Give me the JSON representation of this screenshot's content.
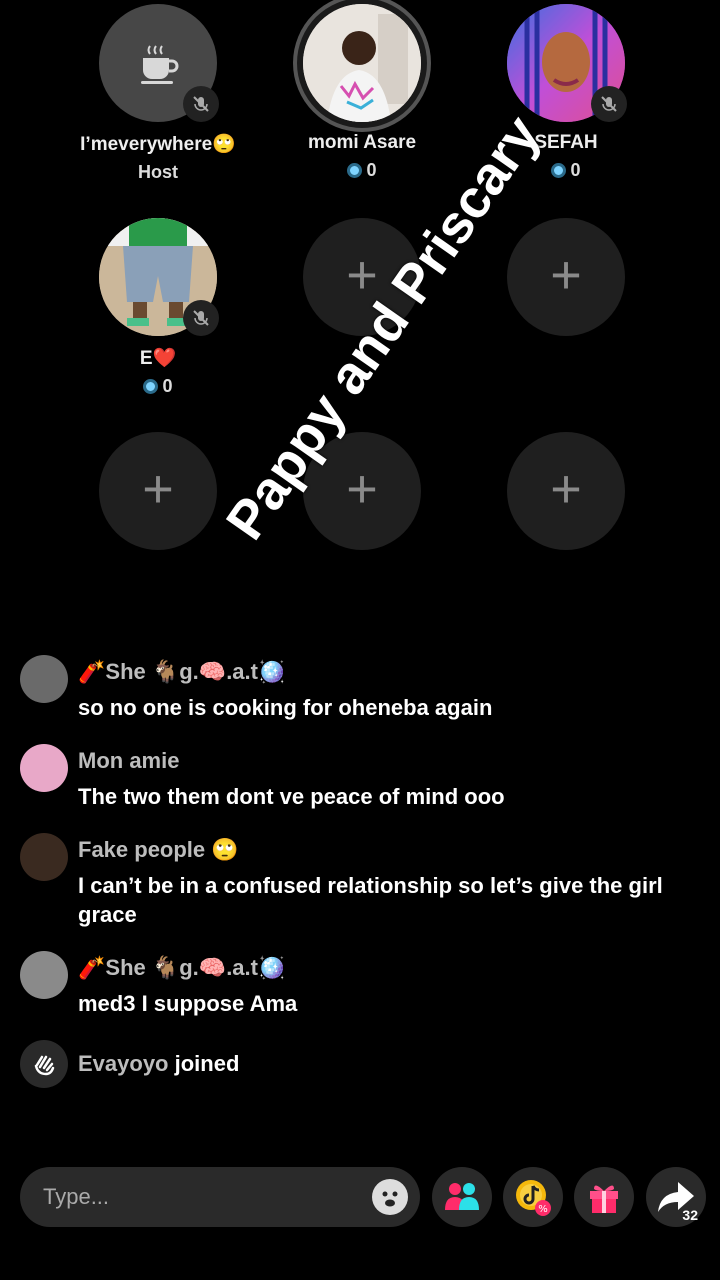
{
  "seats": [
    {
      "name": "I’meverywhere🙄",
      "sub": "Host"
    },
    {
      "name": "momi Asare",
      "score": "0"
    },
    {
      "name": "SEFAH",
      "score": "0"
    },
    {
      "name": "E❤️",
      "score": "0"
    }
  ],
  "watermark": "Pappy and Priscary",
  "comments": [
    {
      "user": "🧨She 🐐g.🧠.a.t🪩",
      "text": "so no one is cooking for oheneba again"
    },
    {
      "user": "Mon amie",
      "text": "The two them dont ve peace of mind ooo"
    },
    {
      "user": "Fake people 🙄",
      "text": "I can’t be in a confused relationship so let’s give the girl grace"
    },
    {
      "user": "🧨She 🐐g.🧠.a.t🪩",
      "text": "med3 I suppose Ama"
    }
  ],
  "joined": {
    "user": "Evayoyo",
    "action": "joined"
  },
  "input": {
    "placeholder": "Type..."
  },
  "share_count": "32",
  "icons": [
    "coffee-icon",
    "mic-off-icon",
    "plus-icon",
    "smile-icon",
    "people-icon",
    "tiktok-coin-icon",
    "gift-icon",
    "share-icon",
    "wave-icon"
  ]
}
